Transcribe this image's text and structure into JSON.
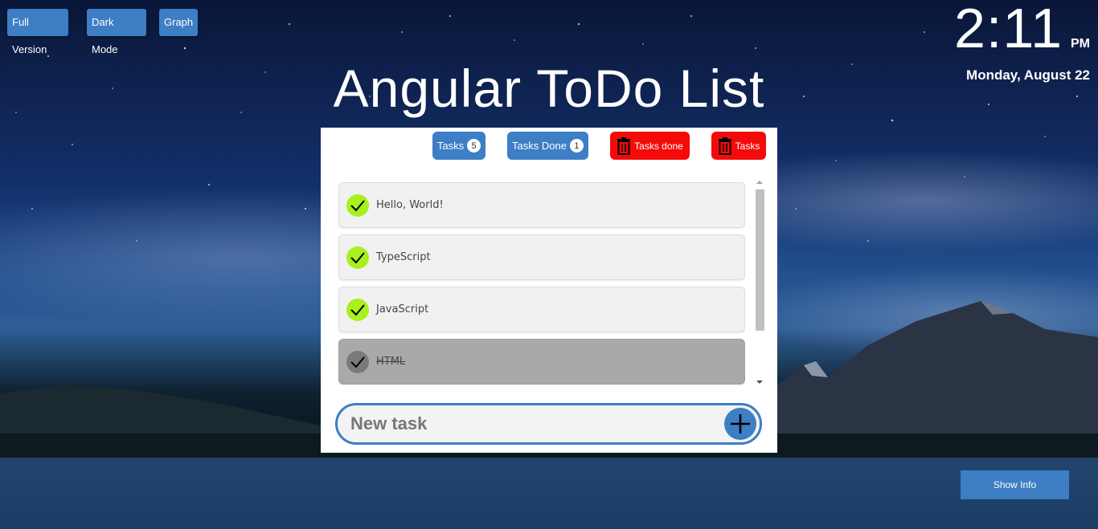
{
  "toolbar": {
    "full_version": "Full Version",
    "dark_mode": "Dark Mode",
    "graph": "Graph"
  },
  "clock": {
    "time": "2:11",
    "ampm": "PM",
    "date": "Monday, August 22"
  },
  "title": "Angular ToDo List",
  "counters": {
    "tasks_label": "Tasks",
    "tasks_count": "5",
    "done_label": "Tasks Done",
    "done_count": "1",
    "delete_done_label": "Tasks done",
    "delete_tasks_label": "Tasks"
  },
  "tasks": [
    {
      "text": "Hello, World!",
      "done": false
    },
    {
      "text": "TypeScript",
      "done": false
    },
    {
      "text": "JavaScript",
      "done": false
    },
    {
      "text": "HTML",
      "done": true
    }
  ],
  "new_task": {
    "placeholder": "New task"
  },
  "show_info": "Show Info",
  "colors": {
    "accent": "#3d7ec4",
    "danger": "#f50a0a",
    "check": "#a8f01e",
    "check_done": "#7a7a7a"
  }
}
